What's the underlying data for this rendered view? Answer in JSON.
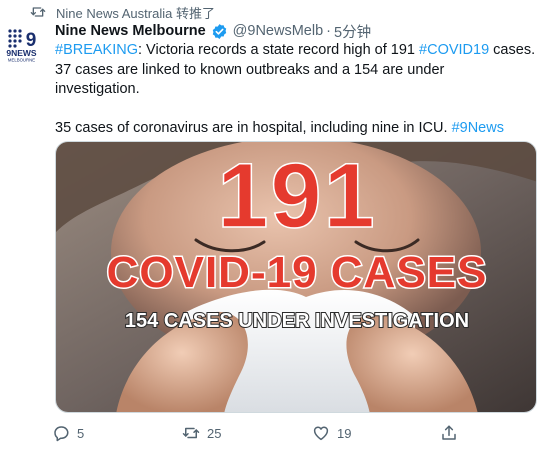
{
  "retweet": {
    "icon": "retweet-icon",
    "text": "Nine News Australia 转推了"
  },
  "author": {
    "avatar_text": "9NEWS",
    "avatar_subtext": "MELBOURNE",
    "name": "Nine News Melbourne",
    "handle": "@9NewsMelb",
    "separator": "·",
    "time": "5分钟",
    "verified": true
  },
  "tweet": {
    "line1_tag": "#BREAKING",
    "line1_text": ": Victoria records a state record high of 191 ",
    "line1_tag2": "#COVID19",
    "line1_text2": " cases.",
    "line2": "37 cases are linked to known outbreaks and a 154 are under",
    "line3": "investigation.",
    "line4_text": "35 cases of coronavirus are in hospital, including nine in ICU. ",
    "line4_tag": "#9News"
  },
  "media": {
    "big_number": "191",
    "headline": "COVID-19 CASES",
    "subline": "154 CASES UNDER INVESTIGATION"
  },
  "actions": {
    "reply_count": "5",
    "retweet_count": "25",
    "like_count": "19"
  },
  "colors": {
    "accent": "#1d9bf0",
    "secondary_text": "#536471",
    "headline_red": "#e53a2e",
    "brand_navy": "#1a2f6e"
  }
}
